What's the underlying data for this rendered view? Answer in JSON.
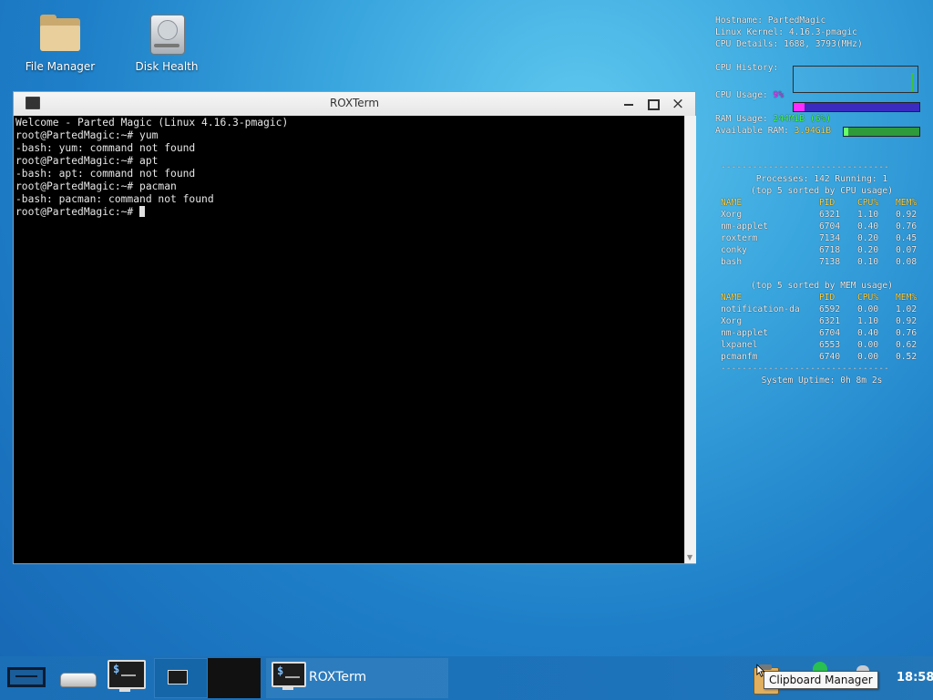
{
  "desktop": {
    "icons": [
      {
        "label": "File Manager",
        "icon": "folder-icon"
      },
      {
        "label": "Disk Health",
        "icon": "hard-drive-icon"
      }
    ]
  },
  "window": {
    "title": "ROXTerm",
    "buttons": {
      "minimize": "minimize-icon",
      "maximize": "maximize-icon",
      "close": "×"
    },
    "terminal_lines": [
      "Welcome - Parted Magic (Linux 4.16.3-pmagic)",
      "",
      "root@PartedMagic:~# yum",
      "-bash: yum: command not found",
      "root@PartedMagic:~# apt",
      "-bash: apt: command not found",
      "root@PartedMagic:~# pacman",
      "-bash: pacman: command not found"
    ],
    "prompt": "root@PartedMagic:~# "
  },
  "conky": {
    "hostname_label": "Hostname: ",
    "hostname": "PartedMagic",
    "kernel_label": "Linux Kernel: ",
    "kernel": "4.16.3-pmagic",
    "cpu_details_label": "CPU Details: ",
    "cpu_details": "1688, 3793(MHz)",
    "cpu_history_label": "CPU History:",
    "cpu_usage_label": "CPU Usage: ",
    "cpu_usage": "9%",
    "cpu_usage_fraction": 0.09,
    "ram_usage_label": "RAM Usage: ",
    "ram_usage": "244MiB (6%)",
    "ram_usage_fraction": 0.06,
    "available_ram_label": "Available RAM: ",
    "available_ram": "3.94GiB",
    "dashes": "--------------------------------",
    "processes_line": "Processes: 142  Running: 1",
    "top_cpu_title": "(top 5 sorted by CPU usage)",
    "top_mem_title": "(top 5 sorted by MEM usage)",
    "columns": [
      "NAME",
      "PID",
      "CPU%",
      "MEM%"
    ],
    "top_cpu": [
      [
        "Xorg",
        "6321",
        "1.10",
        "0.92"
      ],
      [
        "nm-applet",
        "6704",
        "0.40",
        "0.76"
      ],
      [
        "roxterm",
        "7134",
        "0.20",
        "0.45"
      ],
      [
        "conky",
        "6718",
        "0.20",
        "0.07"
      ],
      [
        "bash",
        "7138",
        "0.10",
        "0.08"
      ]
    ],
    "top_mem": [
      [
        "notification-da",
        "6592",
        "0.00",
        "1.02"
      ],
      [
        "Xorg",
        "6321",
        "1.10",
        "0.92"
      ],
      [
        "nm-applet",
        "6704",
        "0.40",
        "0.76"
      ],
      [
        "lxpanel",
        "6553",
        "0.00",
        "0.62"
      ],
      [
        "pcmanfm",
        "6740",
        "0.00",
        "0.52"
      ]
    ],
    "uptime_label": "System Uptime: ",
    "uptime": "0h 8m 2s"
  },
  "taskbar": {
    "task_label": "ROXTerm",
    "tooltip": "Clipboard Manager",
    "clock": "18:58"
  }
}
